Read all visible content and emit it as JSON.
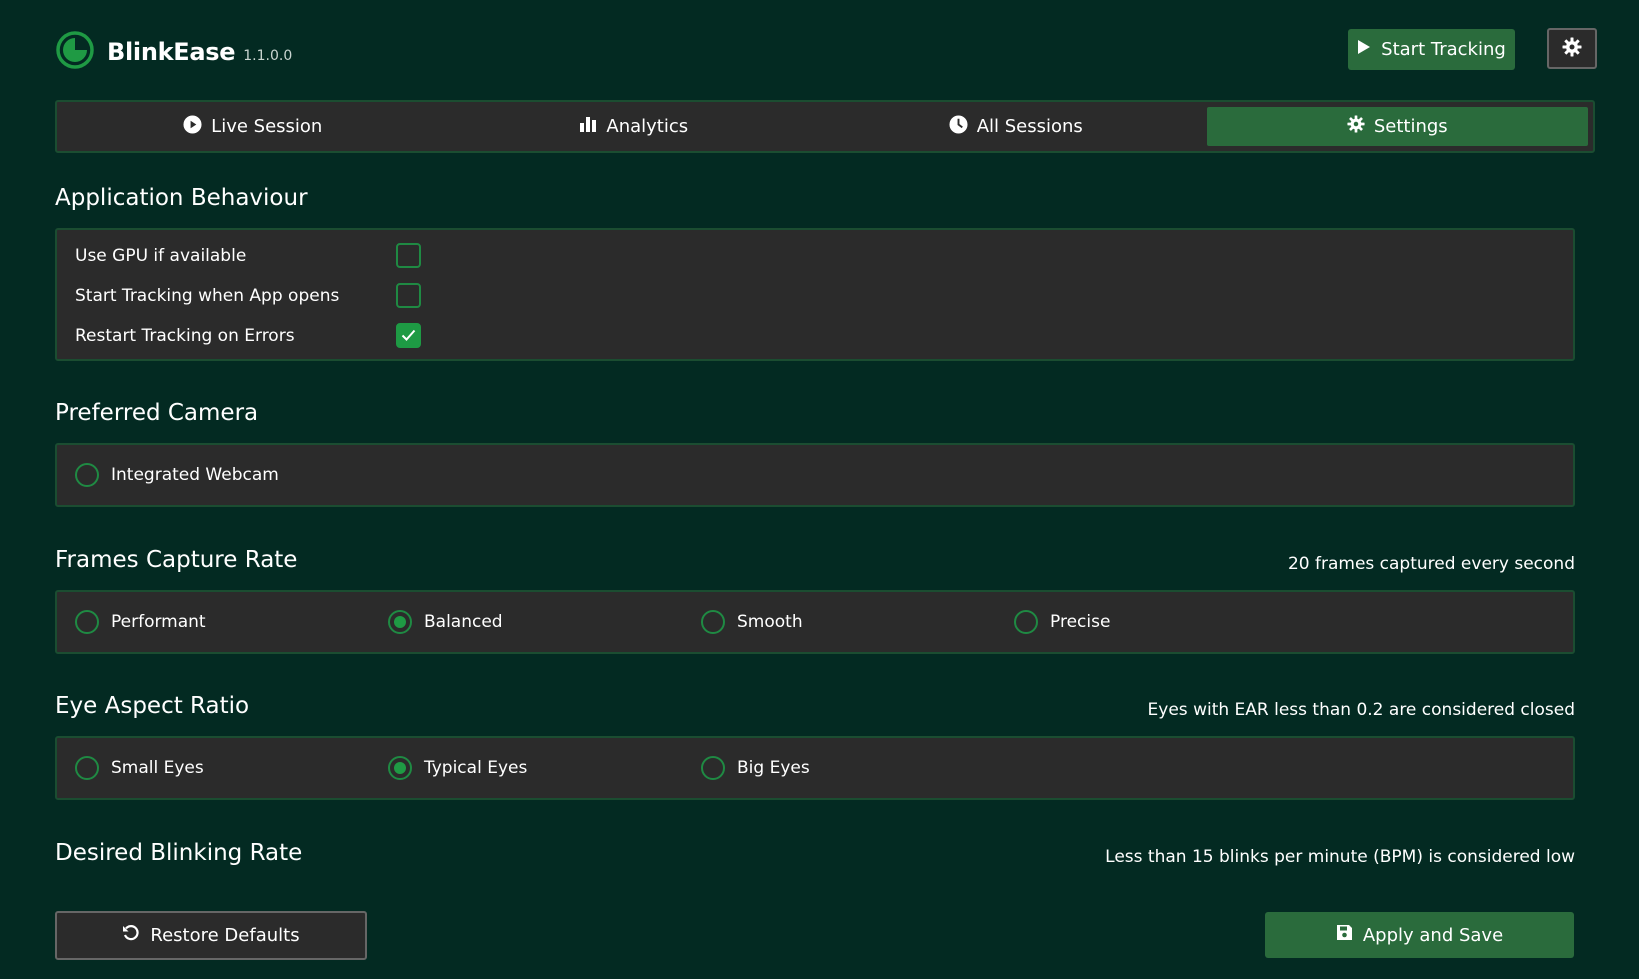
{
  "app": {
    "name": "BlinkEase",
    "version": "1.1.0.0",
    "accent": "#2a6b3c",
    "background": "#032a22",
    "panel": "#2b2b2b"
  },
  "header": {
    "start_tracking_label": "Start Tracking",
    "start_icon": "play-icon",
    "gear_icon": "gear-icon"
  },
  "tabs": [
    {
      "label": "Live Session",
      "icon": "play-circle-icon",
      "active": false
    },
    {
      "label": "Analytics",
      "icon": "bar-chart-icon",
      "active": false
    },
    {
      "label": "All Sessions",
      "icon": "clock-icon",
      "active": false
    },
    {
      "label": "Settings",
      "icon": "gear-icon",
      "active": true
    }
  ],
  "behaviour": {
    "title": "Application Behaviour",
    "options": [
      {
        "label": "Use GPU if available",
        "checked": false
      },
      {
        "label": "Start Tracking when App opens",
        "checked": false
      },
      {
        "label": "Restart Tracking on Errors",
        "checked": true
      }
    ]
  },
  "camera": {
    "title": "Preferred Camera",
    "options": [
      {
        "label": "Integrated Webcam",
        "selected": false
      }
    ]
  },
  "frames": {
    "title": "Frames Capture Rate",
    "note": "20 frames captured every second",
    "options": [
      {
        "label": "Performant",
        "selected": false
      },
      {
        "label": "Balanced",
        "selected": true
      },
      {
        "label": "Smooth",
        "selected": false
      },
      {
        "label": "Precise",
        "selected": false
      }
    ]
  },
  "ear": {
    "title": "Eye Aspect Ratio",
    "note": "Eyes with EAR less than 0.2 are considered closed",
    "options": [
      {
        "label": "Small Eyes",
        "selected": false
      },
      {
        "label": "Typical Eyes",
        "selected": true
      },
      {
        "label": "Big Eyes",
        "selected": false
      }
    ]
  },
  "blink": {
    "title": "Desired Blinking Rate",
    "note": "Less than 15 blinks per minute (BPM) is considered low"
  },
  "footer": {
    "restore_label": "Restore Defaults",
    "apply_label": "Apply and Save"
  }
}
